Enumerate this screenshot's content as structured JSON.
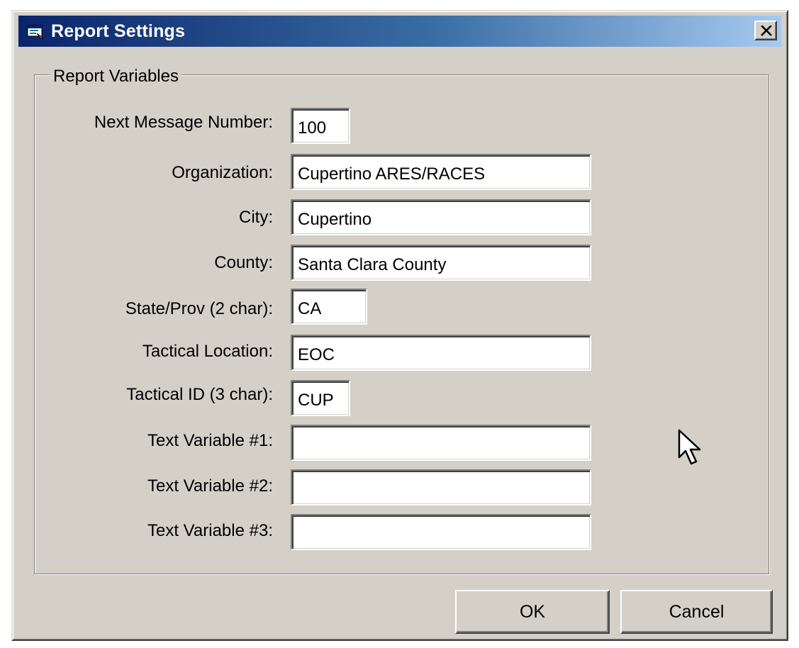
{
  "window": {
    "title": "Report Settings",
    "close_label": "×"
  },
  "group": {
    "legend": "Report Variables"
  },
  "fields": {
    "next_message_number": {
      "label": "Next Message Number:",
      "value": "100"
    },
    "organization": {
      "label": "Organization:",
      "value": "Cupertino ARES/RACES"
    },
    "city": {
      "label": "City:",
      "value": "Cupertino"
    },
    "county": {
      "label": "County:",
      "value": "Santa Clara County"
    },
    "state_prov": {
      "label": "State/Prov (2 char):",
      "value": "CA"
    },
    "tactical_location": {
      "label": "Tactical Location:",
      "value": "EOC"
    },
    "tactical_id": {
      "label": "Tactical ID (3 char):",
      "value": "CUP"
    },
    "text_variable_1": {
      "label": "Text Variable #1:",
      "value": ""
    },
    "text_variable_2": {
      "label": "Text Variable #2:",
      "value": ""
    },
    "text_variable_3": {
      "label": "Text Variable #3:",
      "value": ""
    }
  },
  "buttons": {
    "ok_label": "OK",
    "cancel_label": "Cancel"
  },
  "icons": {
    "title_icon": "window-app-icon",
    "close_icon": "close-x-icon",
    "cursor": "mouse-pointer-icon"
  },
  "colors": {
    "titlebar_start": "#0a246a",
    "titlebar_end": "#a6caf0",
    "dialog_face": "#d4d0c8",
    "input_bg": "#ffffff"
  }
}
